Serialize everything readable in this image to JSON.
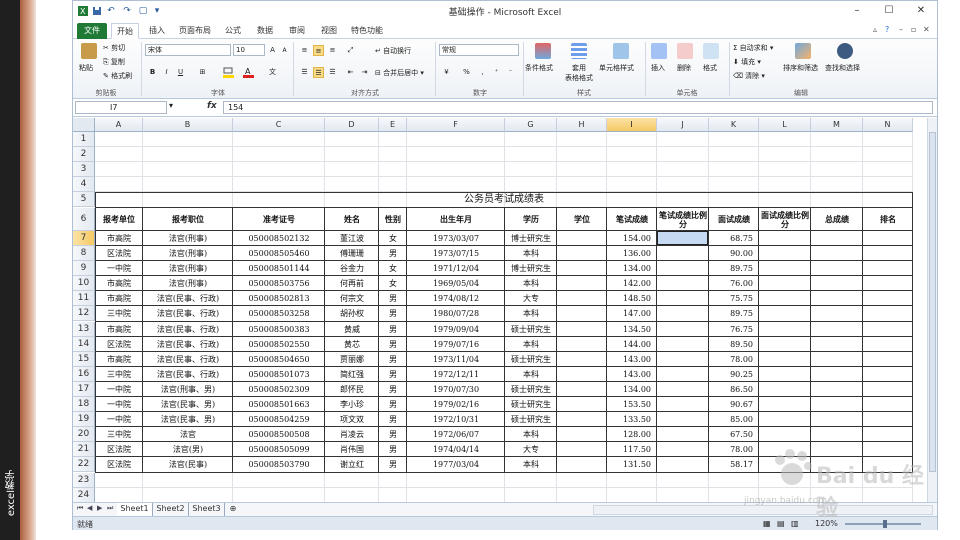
{
  "window": {
    "title": "基础操作 - Microsoft Excel",
    "quick_access": [
      "save-icon",
      "undo-icon",
      "redo-icon",
      "new-icon",
      "customize-icon"
    ]
  },
  "side_caption": "excel教学",
  "ribbon": {
    "tabs": [
      "文件",
      "开始",
      "插入",
      "页面布局",
      "公式",
      "数据",
      "审阅",
      "视图",
      "特色功能"
    ],
    "active_tab": "开始",
    "clipboard": {
      "paste": "粘贴",
      "cut": "剪切",
      "copy": "复制",
      "format_painter": "格式刷",
      "group": "剪贴板"
    },
    "font": {
      "name": "宋体",
      "size": "10",
      "group": "字体",
      "bold": "B",
      "italic": "I",
      "underline": "U",
      "font_color_swatch": "#e02020",
      "fill_color_swatch": "#ffd700"
    },
    "alignment": {
      "wrap_text": "自动换行",
      "merge_center": "合并后居中",
      "group": "对齐方式"
    },
    "number": {
      "format": "常规",
      "group": "数字"
    },
    "styles": {
      "conditional": "条件格式",
      "table_format": "套用\n表格格式",
      "cell_styles": "单元格样式",
      "group": "样式"
    },
    "cells": {
      "insert": "插入",
      "delete": "删除",
      "format": "格式",
      "group": "单元格"
    },
    "editing": {
      "autosum": "自动求和",
      "fill": "填充",
      "clear": "清除",
      "sort_filter": "排序和筛选",
      "find_select": "查找和选择",
      "group": "编辑"
    }
  },
  "formula_bar": {
    "name_box": "I7",
    "fx": "fx",
    "value": "154"
  },
  "sheet": {
    "columns": [
      "A",
      "B",
      "C",
      "D",
      "E",
      "F",
      "G",
      "H",
      "I",
      "J",
      "K",
      "L",
      "M",
      "N"
    ],
    "selected_column": "I",
    "selected_row": "7",
    "row_numbers": [
      "1",
      "2",
      "3",
      "4",
      "5",
      "6",
      "7",
      "8",
      "9",
      "10",
      "11",
      "12",
      "13",
      "14",
      "15",
      "16",
      "17",
      "18",
      "19",
      "20",
      "21",
      "22",
      "23",
      "24"
    ],
    "table_title": "公务员考试成绩表",
    "headers": [
      "报考单位",
      "报考职位",
      "准考证号",
      "姓名",
      "性别",
      "出生年月",
      "学历",
      "学位",
      "笔试成绩",
      "笔试成绩比例分",
      "面试成绩",
      "面试成绩比例分",
      "总成绩",
      "排名"
    ],
    "rows": [
      [
        "市高院",
        "法官(刑事)",
        "050008502132",
        "董江波",
        "女",
        "1973/03/07",
        "博士研究生",
        "",
        "154.00",
        "",
        "68.75",
        "",
        "",
        ""
      ],
      [
        "区法院",
        "法官(刑事)",
        "050008505460",
        "傅珊珊",
        "男",
        "1973/07/15",
        "本科",
        "",
        "136.00",
        "",
        "90.00",
        "",
        "",
        ""
      ],
      [
        "一中院",
        "法官(刑事)",
        "050008501144",
        "谷金力",
        "女",
        "1971/12/04",
        "博士研究生",
        "",
        "134.00",
        "",
        "89.75",
        "",
        "",
        ""
      ],
      [
        "市高院",
        "法官(刑事)",
        "050008503756",
        "何再前",
        "女",
        "1969/05/04",
        "本科",
        "",
        "142.00",
        "",
        "76.00",
        "",
        "",
        ""
      ],
      [
        "市高院",
        "法官(民事、行政)",
        "050008502813",
        "何宗文",
        "男",
        "1974/08/12",
        "大专",
        "",
        "148.50",
        "",
        "75.75",
        "",
        "",
        ""
      ],
      [
        "三中院",
        "法官(民事、行政)",
        "050008503258",
        "胡孙权",
        "男",
        "1980/07/28",
        "本科",
        "",
        "147.00",
        "",
        "89.75",
        "",
        "",
        ""
      ],
      [
        "市高院",
        "法官(民事、行政)",
        "050008500383",
        "黄威",
        "男",
        "1979/09/04",
        "硕士研究生",
        "",
        "134.50",
        "",
        "76.75",
        "",
        "",
        ""
      ],
      [
        "区法院",
        "法官(民事、行政)",
        "050008502550",
        "黄芯",
        "男",
        "1979/07/16",
        "本科",
        "",
        "144.00",
        "",
        "89.50",
        "",
        "",
        ""
      ],
      [
        "市高院",
        "法官(民事、行政)",
        "050008504650",
        "贾丽娜",
        "男",
        "1973/11/04",
        "硕士研究生",
        "",
        "143.00",
        "",
        "78.00",
        "",
        "",
        ""
      ],
      [
        "三中院",
        "法官(民事、行政)",
        "050008501073",
        "简红强",
        "男",
        "1972/12/11",
        "本科",
        "",
        "143.00",
        "",
        "90.25",
        "",
        "",
        ""
      ],
      [
        "一中院",
        "法官(刑事、男)",
        "050008502309",
        "郎怀民",
        "男",
        "1970/07/30",
        "硕士研究生",
        "",
        "134.00",
        "",
        "86.50",
        "",
        "",
        ""
      ],
      [
        "一中院",
        "法官(民事、男)",
        "050008501663",
        "李小珍",
        "男",
        "1979/02/16",
        "硕士研究生",
        "",
        "153.50",
        "",
        "90.67",
        "",
        "",
        ""
      ],
      [
        "一中院",
        "法官(民事、男)",
        "050008504259",
        "项文双",
        "男",
        "1972/10/31",
        "硕士研究生",
        "",
        "133.50",
        "",
        "85.00",
        "",
        "",
        ""
      ],
      [
        "三中院",
        "法官",
        "050008500508",
        "肖凌云",
        "男",
        "1972/06/07",
        "本科",
        "",
        "128.00",
        "",
        "67.50",
        "",
        "",
        ""
      ],
      [
        "区法院",
        "法官(男)",
        "050008505099",
        "肖伟国",
        "男",
        "1974/04/14",
        "大专",
        "",
        "117.50",
        "",
        "78.00",
        "",
        "",
        ""
      ],
      [
        "区法院",
        "法官(民事)",
        "050008503790",
        "谢立红",
        "男",
        "1977/03/04",
        "本科",
        "",
        "131.50",
        "",
        "58.17",
        "",
        "",
        ""
      ]
    ],
    "sheet_tabs": [
      "Sheet1",
      "Sheet2",
      "Sheet3"
    ],
    "active_sheet": "Sheet1"
  },
  "status": {
    "mode": "就绪",
    "zoom": "120%"
  },
  "watermark": {
    "brand": "Bai du 经验",
    "url": "jingyan.baidu.com"
  }
}
